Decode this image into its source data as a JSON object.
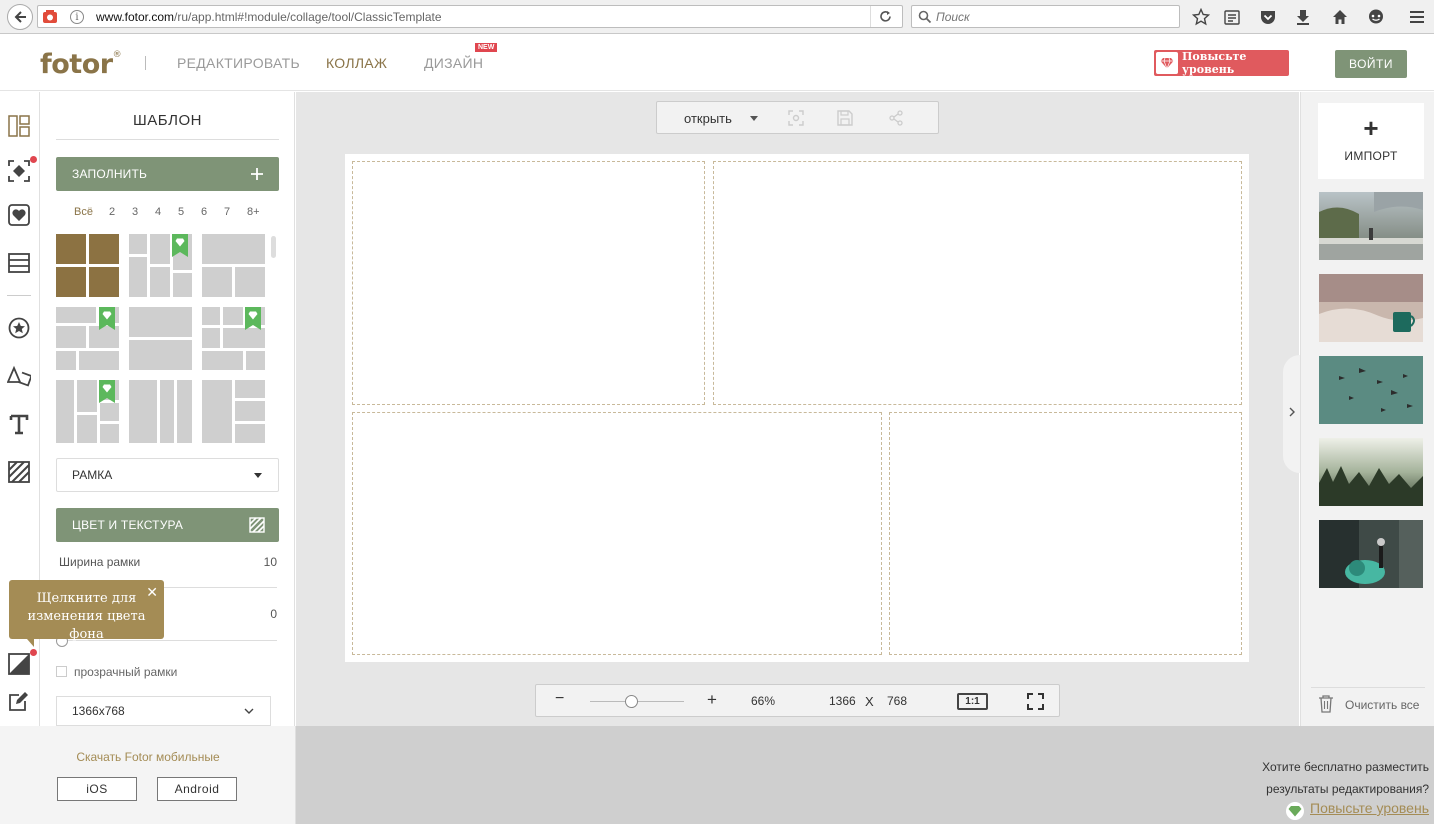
{
  "browser": {
    "url_domain": "www.fotor.com",
    "url_path": "/ru/app.html#!module/collage/tool/ClassicTemplate",
    "search_placeholder": "Поиск",
    "icons": [
      "back-arrow-icon",
      "info-icon",
      "reload-icon",
      "search-icon",
      "bookmark-star-icon",
      "reading-list-icon",
      "pocket-icon",
      "download-icon",
      "home-icon",
      "chat-icon",
      "menu-icon"
    ]
  },
  "header": {
    "logo": "fotor",
    "logo_mark": "®",
    "nav": [
      {
        "label": "РЕДАКТИРОВАТЬ",
        "active": false
      },
      {
        "label": "КОЛЛАЖ",
        "active": true
      },
      {
        "label": "ДИЗАЙН",
        "active": false
      }
    ],
    "new_badge": "NEW",
    "upgrade_label": "Повысьте уровень",
    "login_label": "ВОЙТИ",
    "colors": {
      "brand": "#8a7448",
      "accent_green": "#7f9477",
      "upgrade_red": "#e05a5e"
    }
  },
  "left_panel": {
    "title": "ШАБЛОН",
    "fill_button": "ЗАПОЛНИТЬ",
    "count_tabs": [
      "Всё",
      "2",
      "3",
      "4",
      "5",
      "6",
      "7",
      "8+"
    ],
    "selected_count_tab": "Всё",
    "frame_select": "РАМКА",
    "color_texture_button": "ЦВЕТ И ТЕКСТУРА",
    "border_width_label": "Ширина рамки",
    "border_width_value": "10",
    "rounding_value": "0",
    "transparent_label": "прозрачный рамки",
    "size_select": "1366x768"
  },
  "tooltip": {
    "text_line1": "Щелкните для",
    "text_line2": "изменения цвета фона",
    "close": "✕"
  },
  "canvas_tools": {
    "open_label": "открыть",
    "zoom_minus": "−",
    "zoom_plus": "+",
    "zoom_value": "66%",
    "width": "1366",
    "times": "X",
    "height": "768",
    "ratio_label": "1:1"
  },
  "right_panel": {
    "import_plus": "+",
    "import_label": "ИМПОРТ",
    "clear_all": "Очистить все"
  },
  "footer": {
    "mobile_text": "Скачать Fotor мобильные",
    "ios": "iOS",
    "android": "Android",
    "promo_line1": "Хотите бесплатно разместить",
    "promo_line2": "результаты редактирования?",
    "promo_link": "Повысьте уровень"
  }
}
